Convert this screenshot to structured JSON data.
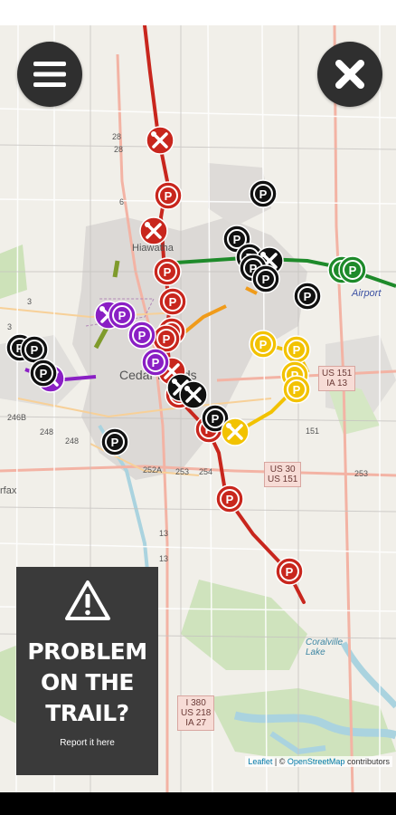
{
  "map": {
    "labels": {
      "hiawatha": "Hiawatha",
      "cedar_rapids": "Cedar Rapids",
      "airport": "Airport",
      "fairfax": "rfax",
      "coralville_lake": "Coralville Lake"
    },
    "shields": {
      "us151_ia13": [
        "US 151",
        "IA 13"
      ],
      "us30_us151": [
        "US 30",
        "US 151"
      ],
      "i380_stack": [
        "I 380",
        "US 218",
        "IA 27"
      ]
    },
    "route_numbers": [
      "28",
      "28",
      "6",
      "3",
      "3",
      "246B",
      "248",
      "248",
      "252A",
      "253",
      "254",
      "253",
      "13",
      "13",
      "151"
    ],
    "trail_colors": {
      "red": "#c8261d",
      "green": "#1e8a2a",
      "purple": "#8a1fc4",
      "yellow": "#f2c200",
      "orange": "#f09b1a",
      "olive": "#7f9b2c",
      "black": "#111111"
    },
    "marker_icons": {
      "parking": "parking-icon",
      "repair": "bike-repair-icon"
    },
    "parking_letter": "P"
  },
  "controls": {
    "menu_button": "menu-icon",
    "close_button": "close-icon"
  },
  "problem_panel": {
    "icon": "warning-icon",
    "headline_lines": [
      "PROBLEM",
      "ON THE",
      "TRAIL?"
    ],
    "link_text": "Report it here"
  },
  "attribution": {
    "leaflet": "Leaflet",
    "separator": "| ©",
    "osm": "OpenStreetMap",
    "contributors": "contributors"
  }
}
